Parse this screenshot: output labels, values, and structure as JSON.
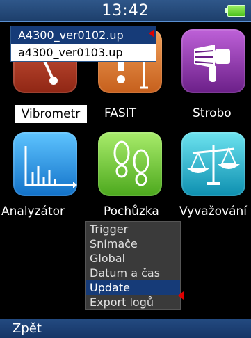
{
  "status": {
    "time": "13:42"
  },
  "file_list": {
    "items": [
      {
        "name": "A4300_ver0102.up",
        "selected": true
      },
      {
        "name": "a4300_ver0103.up",
        "selected": false
      }
    ]
  },
  "apps": [
    {
      "label": "Vibrometr",
      "icon": "needle-gauge-icon",
      "selected": true
    },
    {
      "label": "FASIT",
      "icon": "fasit-tool-icon"
    },
    {
      "label": "Strobo",
      "icon": "stroboscope-icon"
    },
    {
      "label": "Analyzátor",
      "icon": "spectrum-chart-icon"
    },
    {
      "label": "Pochůzka",
      "icon": "footprints-icon"
    },
    {
      "label": "Vyvažování",
      "icon": "balance-scale-icon"
    }
  ],
  "menu": {
    "items": [
      "Trigger",
      "Snímače",
      "Global",
      "Datum a čas",
      "Update",
      "Export logů"
    ],
    "selected_index": 4
  },
  "bottom": {
    "back_label": "Zpět"
  },
  "colors": {
    "selection": "#163b78",
    "marker": "#e00000",
    "statusbar": "#2f578a"
  }
}
